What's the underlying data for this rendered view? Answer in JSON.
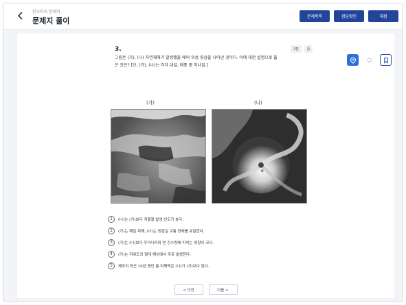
{
  "header": {
    "breadcrumb": "한국지리 문제지",
    "title": "문제지 풀이",
    "buttons": [
      "문제목록",
      "정답확인",
      "채점"
    ]
  },
  "question": {
    "number": "3.",
    "text": "그림은 (가), (나) 자연재해가 발생했을 때의 위성 영상을 나타낸 것이다. 이에 대한 설명으로 옳은 것은? [단, (가), (나)는 각각 대설, 태풍 중 하나임.]",
    "meta": [
      "3점",
      "중"
    ],
    "figure_labels": [
      "(가)",
      "(나)"
    ],
    "options": [
      {
        "num": "1",
        "text": "(나)는 (가)보다 겨울철 발생 빈도가 높다."
      },
      {
        "num": "2",
        "text": "(가)는 해일 피해, (나)는 빙판길 교통 장애를 유발한다."
      },
      {
        "num": "3",
        "text": "(가)는 (나)보다 우리나라의 연 강수량에 미치는 영향이 크다."
      },
      {
        "num": "4",
        "text": "(가)는 저위도의 열대 해상에서 주로 발생한다."
      },
      {
        "num": "5",
        "text": "제주의 최근 10년 동안 총 피해액은 (나)가 (가)보다 많다."
      }
    ]
  },
  "toolbar": {
    "icons": [
      "location-pin-icon",
      "bell-icon",
      "bookmark-icon"
    ],
    "accent": "#2d6fd6",
    "header_button_color": "#22449a"
  },
  "pager": {
    "prev": "< 이전",
    "next": "다음 >"
  }
}
